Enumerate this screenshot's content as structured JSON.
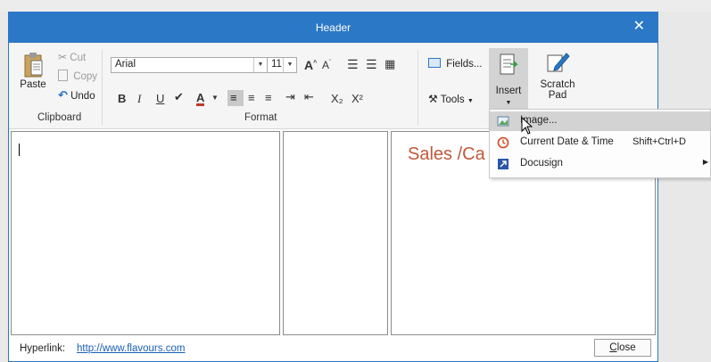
{
  "dialog": {
    "title": "Header",
    "accent_color": "#2b78c6"
  },
  "ribbon": {
    "clipboard": {
      "group_label": "Clipboard",
      "paste_label": "Paste",
      "cut_label": "Cut",
      "copy_label": "Copy",
      "undo_label": "Undo"
    },
    "format": {
      "group_label": "Format",
      "font_name": "Arial",
      "font_size": "11",
      "grow_font": "A",
      "shrink_font": "A",
      "bold": "B",
      "italic": "I",
      "underline": "U",
      "font_color": "A",
      "subscript": "X₂",
      "superscript": "X²"
    },
    "fields_label": "Fields...",
    "tools_label": "Tools",
    "insert_label": "Insert",
    "scratch_label_1": "Scratch",
    "scratch_label_2": "Pad"
  },
  "editor": {
    "right_pane_text": "Sales /Ca"
  },
  "insert_menu": {
    "items": [
      {
        "label": "Image...",
        "shortcut": "",
        "icon": "image-icon"
      },
      {
        "label": "Current Date & Time",
        "shortcut": "Shift+Ctrl+D",
        "icon": "clock-icon"
      },
      {
        "label": "Docusign",
        "shortcut": "",
        "icon": "docusign-icon"
      }
    ]
  },
  "footer": {
    "hyperlink_label": "Hyperlink:",
    "hyperlink_url": "http://www.flavours.com",
    "close_prefix": "",
    "close_accel": "C",
    "close_rest": "lose"
  }
}
